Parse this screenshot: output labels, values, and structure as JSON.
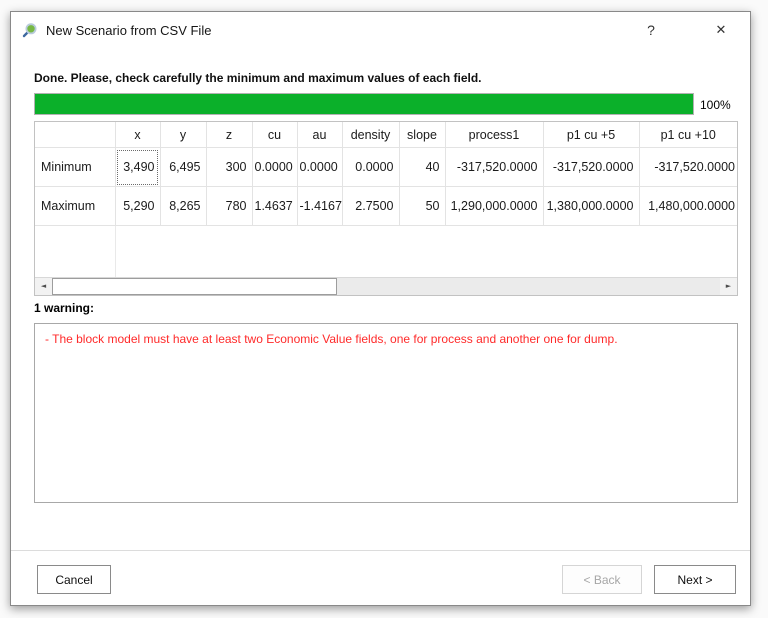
{
  "window": {
    "title": "New Scenario from CSV File"
  },
  "icons": {
    "help": "?",
    "close": "✕",
    "scroll_left": "◄",
    "scroll_right": "►"
  },
  "status": {
    "message": "Done. Please, check carefully the minimum and maximum values of each field.",
    "progress_percent": 100,
    "progress_label": "100%",
    "progress_color": "#0bb02a"
  },
  "table": {
    "columns": [
      "",
      "x",
      "y",
      "z",
      "cu",
      "au",
      "density",
      "slope",
      "process1",
      "p1 cu +5",
      "p1 cu +10"
    ],
    "rows": [
      {
        "label": "Minimum",
        "values": [
          "3,490",
          "6,495",
          "300",
          "0.0000",
          "0.0000",
          "0.0000",
          "40",
          "-317,520.0000",
          "-317,520.0000",
          "-317,520.0000"
        ]
      },
      {
        "label": "Maximum",
        "values": [
          "5,290",
          "8,265",
          "780",
          "1.4637",
          "-1.4167",
          "2.7500",
          "50",
          "1,290,000.0000",
          "1,380,000.0000",
          "1,480,000.0000"
        ]
      }
    ]
  },
  "warnings": {
    "header": "1 warning:",
    "items": [
      "- The block model must have at least two Economic Value fields, one for process and another one for dump."
    ],
    "text_color": "#ff2a2a"
  },
  "buttons": {
    "cancel": "Cancel",
    "back": "< Back",
    "next": "Next >"
  }
}
